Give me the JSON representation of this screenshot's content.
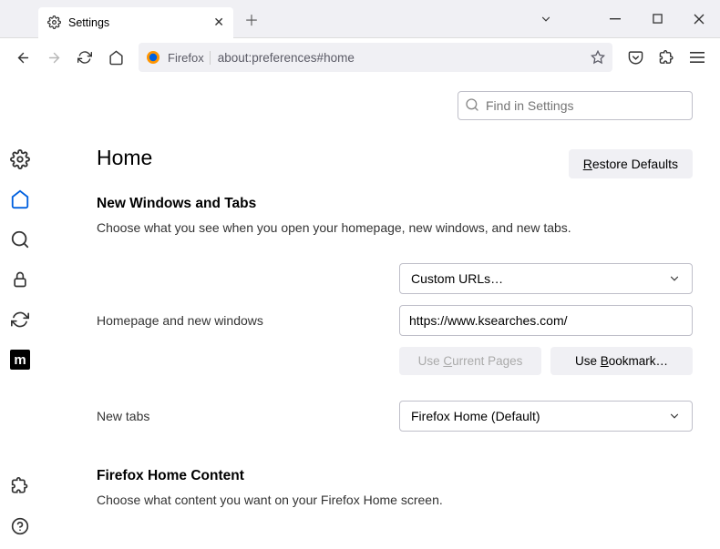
{
  "tab": {
    "title": "Settings"
  },
  "urlbar": {
    "context": "Firefox",
    "address": "about:preferences#home"
  },
  "search": {
    "placeholder": "Find in Settings"
  },
  "page": {
    "heading": "Home",
    "restore_btn": "Restore Defaults",
    "section1": {
      "title": "New Windows and Tabs",
      "desc": "Choose what you see when you open your homepage, new windows, and new tabs."
    },
    "row_homepage": {
      "label": "Homepage and new windows",
      "select_value": "Custom URLs…",
      "input_value": "https://www.ksearches.com/",
      "btn_use_current": "Use Current Pages",
      "btn_use_bookmark": "Use Bookmark…"
    },
    "row_newtabs": {
      "label": "New tabs",
      "select_value": "Firefox Home (Default)"
    },
    "section2": {
      "title": "Firefox Home Content",
      "desc": "Choose what content you want on your Firefox Home screen."
    }
  }
}
